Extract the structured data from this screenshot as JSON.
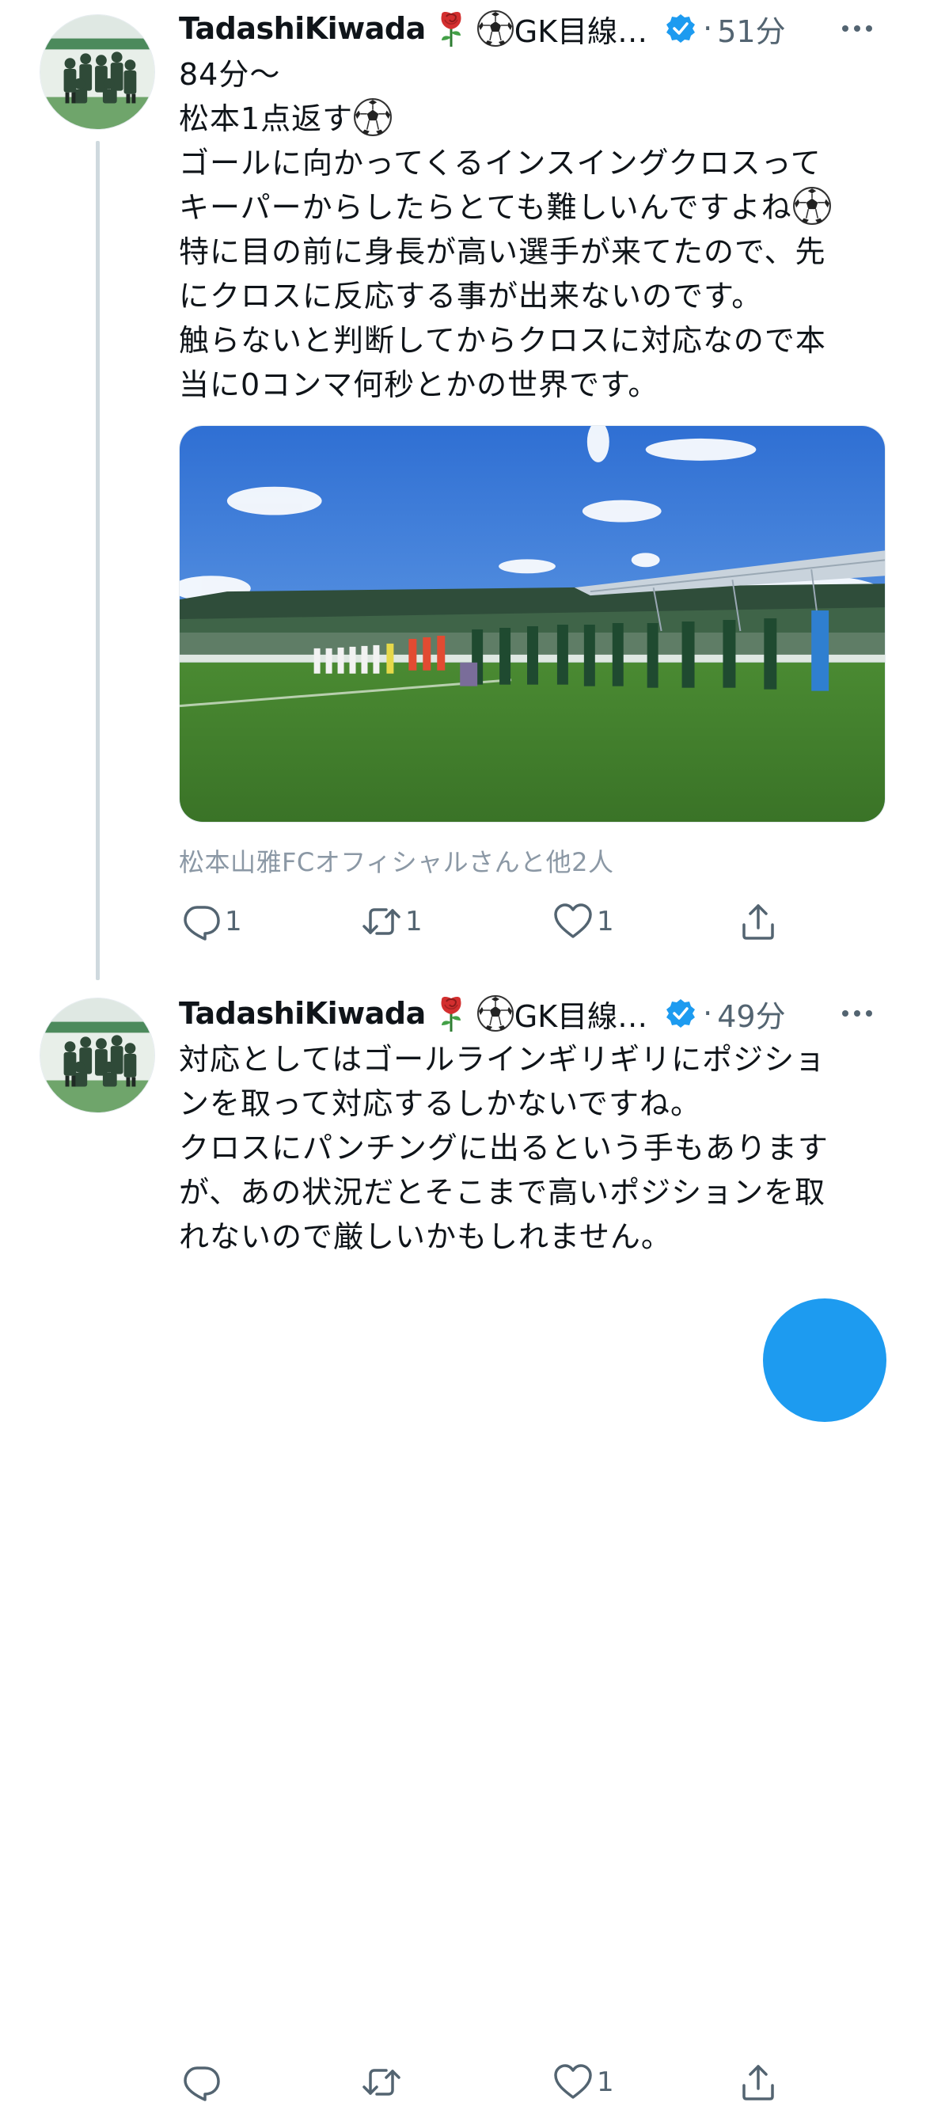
{
  "colors": {
    "verified": "#1d9bf0",
    "secondary_text": "#536471",
    "tagged_text": "#8b98a5",
    "thread_line": "#cfd9de"
  },
  "tweets": [
    {
      "display_name": "TadashiKiwada",
      "emoji_icons": [
        "rose-icon",
        "soccer-ball-icon"
      ],
      "name_suffix": "GK目線…",
      "separator": "·",
      "time": "51分",
      "lines": [
        "84分〜",
        "松本1点返す",
        "ゴールに向かってくるインスイングクロスって",
        "キーパーからしたらとても難しいんですよね",
        "特に目の前に身長が高い選手が来てたので、先",
        "にクロスに反応する事が出来ないのです。",
        "触らないと判断してからクロスに対応なので本",
        "当に0コンマ何秒とかの世界です。"
      ],
      "media_alt_icon": "stadium-photo",
      "tagged": "松本山雅FCオフィシャルさんと他2人",
      "counts": {
        "reply": "1",
        "retweet": "1",
        "like": "1"
      }
    },
    {
      "display_name": "TadashiKiwada",
      "emoji_icons": [
        "rose-icon",
        "soccer-ball-icon"
      ],
      "name_suffix": "GK目線…",
      "separator": "·",
      "time": "49分",
      "lines": [
        "対応としてはゴールラインギリギリにポジショ",
        "ンを取って対応するしかないですね。",
        "クロスにパンチングに出るという手もあります",
        "が、あの状況だとそこまで高いポジションを取",
        "れないので厳しいかもしれません。"
      ],
      "counts": {
        "reply": "",
        "retweet": "",
        "like": "1"
      }
    }
  ]
}
